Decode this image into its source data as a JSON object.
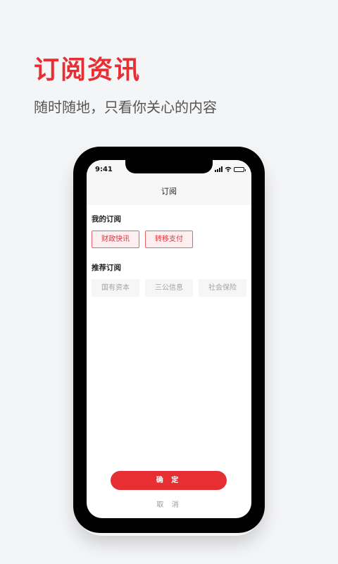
{
  "promo": {
    "title": "订阅资讯",
    "subtitle": "随时随地，只看你关心的内容"
  },
  "status_bar": {
    "time": "9:41",
    "icons": [
      "signal-icon",
      "wifi-icon",
      "battery-icon"
    ]
  },
  "nav": {
    "title": "订阅"
  },
  "my_subscriptions": {
    "title": "我的订阅",
    "items": [
      "财政快讯",
      "转移支付"
    ]
  },
  "recommended": {
    "title": "推荐订阅",
    "items": [
      "国有资本",
      "三公信息",
      "社会保险"
    ]
  },
  "actions": {
    "confirm": "确 定",
    "cancel": "取 消"
  },
  "colors": {
    "accent": "#e62e33",
    "selected_bg": "#fdeef0",
    "background": "#f4f5f7"
  }
}
